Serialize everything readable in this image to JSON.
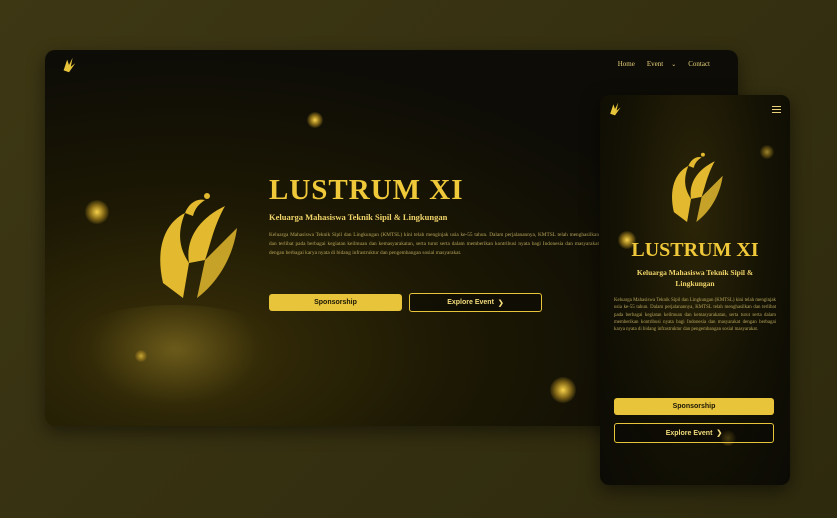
{
  "desktop": {
    "nav": {
      "home": "Home",
      "event": "Event",
      "contact": "Contact"
    },
    "title": "LUSTRUM XI",
    "subtitle": "Keluarga Mahasiswa Teknik Sipil & Lingkungan",
    "description": "Keluarga Mahasiswa Teknik Sipil dan Lingkungan (KMTSL) kini telah menginjak usia ke-55 tahun. Dalam perjalanannya, KMTSL telah menghasilkan dan terlibat pada berbagai kegiatan keilmuan dan kemasyarakatan, serta turut serta dalam memberikan kontribusi nyata bagi Indonesia dan masyarakat dengan berbagai karya nyata di bidang infrastruktur dan pengembangan sosial masyarakat.",
    "buttons": {
      "sponsorship": "Sponsorship",
      "explore": "Explore Event"
    }
  },
  "mobile": {
    "title": "LUSTRUM XI",
    "subtitle": "Keluarga Mahasiswa Teknik Sipil & Lingkungan",
    "description": "Keluarga Mahasiswa Teknik Sipil dan Lingkungan (KMTSL) kini telah menginjak usia ke-55 tahun. Dalam perjalanannya, KMTSL telah menghasilkan dan terlibat pada berbagai kegiatan keilmuan dan kemasyarakatan, serta turut serta dalam memberikan kontribusi nyata bagi Indonesia dan masyarakat dengan berbagai karya nyata di bidang infrastruktur dan pengembangan sosial masyarakat.",
    "buttons": {
      "sponsorship": "Sponsorship",
      "explore": "Explore Event"
    }
  },
  "colors": {
    "accent": "#e8c43a",
    "background": "#3a3413",
    "panel": "#0d0c06"
  },
  "icons": {
    "logo": "phoenix-logo-icon",
    "menu": "hamburger-menu-icon",
    "chevron": "chevron-down-icon",
    "arrow": "chevron-right-icon"
  }
}
